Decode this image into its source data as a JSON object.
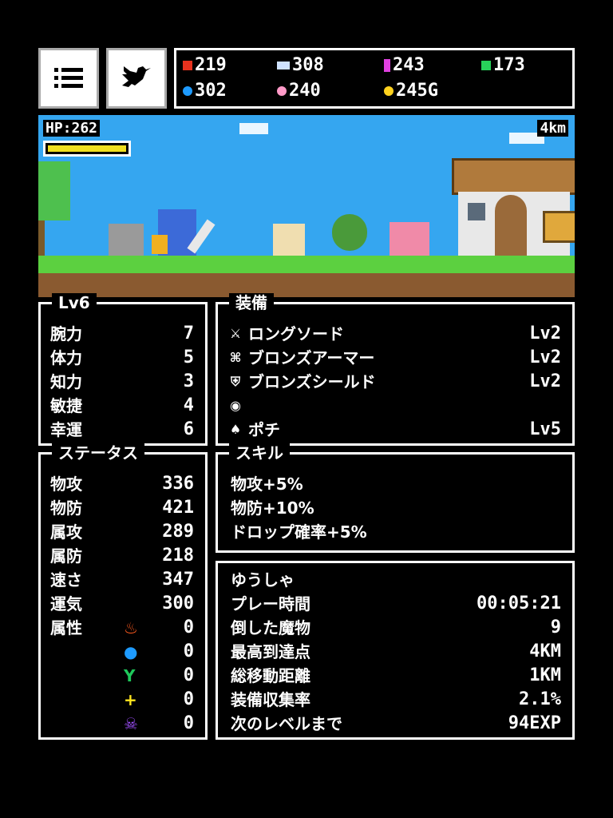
{
  "resources": {
    "red": "219",
    "diamond": "308",
    "purple": "243",
    "green": "173",
    "blue": "302",
    "pink": "240",
    "gold": "245G"
  },
  "scene": {
    "hp_label": "HP:262",
    "hp_fraction": 1.0,
    "distance": "4km"
  },
  "level_panel": {
    "title": "Lv6",
    "rows": [
      {
        "label": "腕力",
        "value": "7"
      },
      {
        "label": "体力",
        "value": "5"
      },
      {
        "label": "知力",
        "value": "3"
      },
      {
        "label": "敏捷",
        "value": "4"
      },
      {
        "label": "幸運",
        "value": "6"
      }
    ]
  },
  "equipment_panel": {
    "title": "装備",
    "items": [
      {
        "icon": "sword-icon",
        "name": "ロングソード",
        "level": "Lv2"
      },
      {
        "icon": "armor-icon",
        "name": "ブロンズアーマー",
        "level": "Lv2"
      },
      {
        "icon": "shield-icon",
        "name": "ブロンズシールド",
        "level": "Lv2"
      },
      {
        "icon": "accessory-icon",
        "name": "",
        "level": ""
      },
      {
        "icon": "pet-icon",
        "name": "ポチ",
        "level": "Lv5"
      }
    ]
  },
  "status_panel": {
    "title": "ステータス",
    "rows": [
      {
        "label": "物攻",
        "value": "336"
      },
      {
        "label": "物防",
        "value": "421"
      },
      {
        "label": "属攻",
        "value": "289"
      },
      {
        "label": "属防",
        "value": "218"
      },
      {
        "label": "速さ",
        "value": "347"
      },
      {
        "label": "運気",
        "value": "300"
      }
    ],
    "attribute_label": "属性",
    "attributes": [
      {
        "icon": "fire-icon",
        "value": "0",
        "color": "#ff5a1e"
      },
      {
        "icon": "water-icon",
        "value": "0",
        "color": "#1e9bff"
      },
      {
        "icon": "wind-icon",
        "value": "0",
        "color": "#1ec85a"
      },
      {
        "icon": "holy-icon",
        "value": "0",
        "color": "#ffe61e"
      },
      {
        "icon": "dark-icon",
        "value": "0",
        "color": "#a050ff"
      }
    ]
  },
  "skill_panel": {
    "title": "スキル",
    "items": [
      "物攻+5%",
      "物防+10%",
      "ドロップ確率+5%"
    ]
  },
  "info_panel": {
    "name": "ゆうしゃ",
    "rows": [
      {
        "label": "プレー時間",
        "value": "00:05:21"
      },
      {
        "label": "倒した魔物",
        "value": "9"
      },
      {
        "label": "最高到達点",
        "value": "4KM"
      },
      {
        "label": "総移動距離",
        "value": "1KM"
      },
      {
        "label": "装備収集率",
        "value": "2.1%"
      },
      {
        "label": "次のレベルまで",
        "value": "94EXP"
      }
    ]
  }
}
